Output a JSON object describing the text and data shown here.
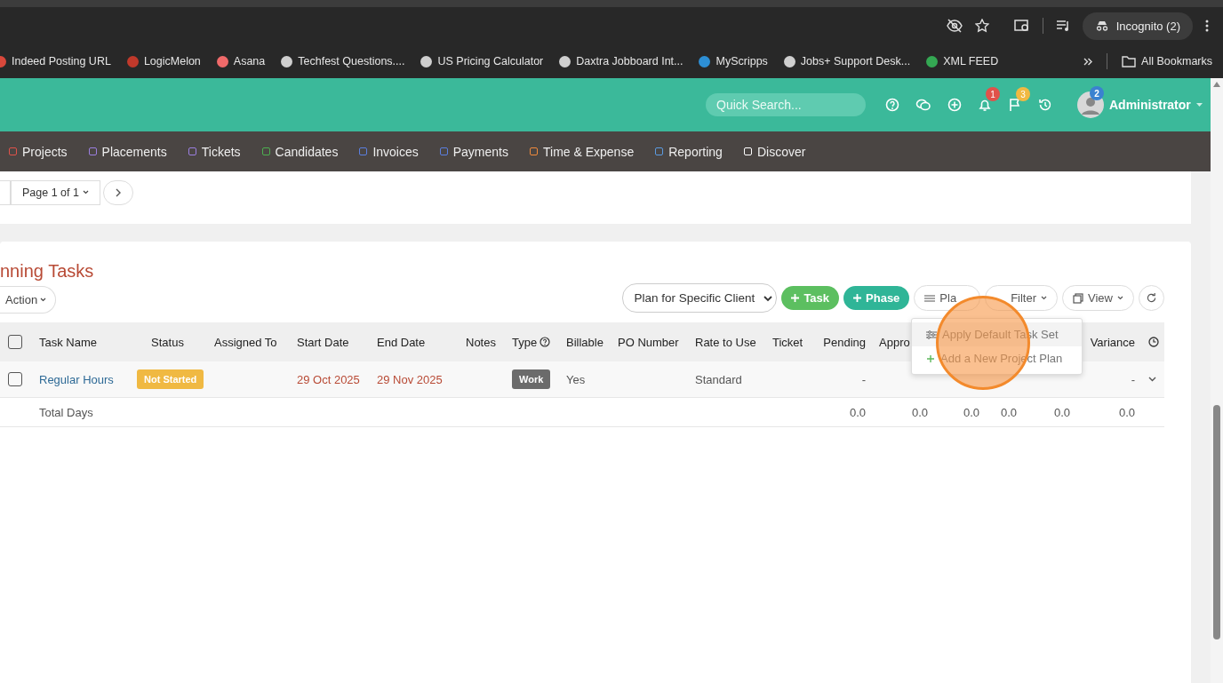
{
  "browser": {
    "incognito": "Incognito (2)",
    "all_bookmarks": "All Bookmarks",
    "bookmarks": [
      {
        "label": "Indeed Posting URL",
        "color": "#d9483b"
      },
      {
        "label": "LogicMelon",
        "color": "#c0392b"
      },
      {
        "label": "Asana",
        "color": "#f06a6a"
      },
      {
        "label": "Techfest Questions....",
        "color": "#cfcfcf"
      },
      {
        "label": "US Pricing Calculator",
        "color": "#cfcfcf"
      },
      {
        "label": "Daxtra Jobboard Int...",
        "color": "#cfcfcf"
      },
      {
        "label": "MyScripps",
        "color": "#2d8fd5"
      },
      {
        "label": "Jobs+ Support Desk...",
        "color": "#cfcfcf"
      },
      {
        "label": "XML FEED",
        "color": "#34a853"
      }
    ]
  },
  "header": {
    "search": {
      "placeholder": "Quick Search..."
    },
    "notifications": "1",
    "flags": "3",
    "avatar_badge": "2",
    "user": "Administrator"
  },
  "nav": [
    {
      "label": "Projects",
      "color": "#e0524a"
    },
    {
      "label": "Placements",
      "color": "#9b7fe0"
    },
    {
      "label": "Tickets",
      "color": "#9b7fe0"
    },
    {
      "label": "Candidates",
      "color": "#4caf50"
    },
    {
      "label": "Invoices",
      "color": "#5b7fe0"
    },
    {
      "label": "Payments",
      "color": "#5b7fe0"
    },
    {
      "label": "Time & Expense",
      "color": "#f08a3c"
    },
    {
      "label": "Reporting",
      "color": "#5b9be0"
    },
    {
      "label": "Discover",
      "color": "#ffffff"
    }
  ],
  "pager": {
    "page": "Page 1 of 1"
  },
  "tasks": {
    "title": "nning Tasks",
    "action": "Action",
    "plan_select": "Plan for Specific Client",
    "select_all": {
      "checked": false
    },
    "buttons": {
      "task": "Task",
      "phase": "Phase",
      "plan": "Pla",
      "filter": "Filter",
      "view": "View"
    },
    "columns": [
      "Task Name",
      "Status",
      "Assigned To",
      "Start Date",
      "End Date",
      "Notes",
      "Type",
      "Billable",
      "PO Number",
      "Rate to Use",
      "Ticket",
      "Pending",
      "Appro",
      "Variance"
    ],
    "rows": [
      {
        "selected": false,
        "task": "Regular Hours",
        "status": "Not Started",
        "start": "29 Oct 2025",
        "end": "29 Nov 2025",
        "type": "Work",
        "billable": "Yes",
        "rate": "Standard",
        "pending": "-",
        "variance": "-"
      }
    ],
    "totals": {
      "label": "Total Days",
      "values": [
        "0.0",
        "0.0",
        "0.0",
        "0.0",
        "0.0",
        "0.0"
      ]
    },
    "menu": [
      {
        "kind": "sliders",
        "label": "Apply Default Task Set"
      },
      {
        "kind": "plus",
        "label": "Add a New Project Plan"
      }
    ]
  }
}
